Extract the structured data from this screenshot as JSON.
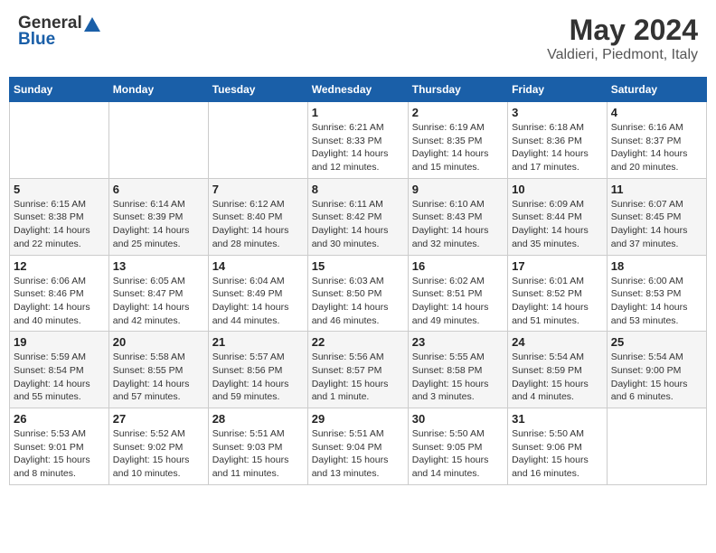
{
  "header": {
    "logo_general": "General",
    "logo_blue": "Blue",
    "month_year": "May 2024",
    "location": "Valdieri, Piedmont, Italy"
  },
  "calendar": {
    "days_of_week": [
      "Sunday",
      "Monday",
      "Tuesday",
      "Wednesday",
      "Thursday",
      "Friday",
      "Saturday"
    ],
    "weeks": [
      [
        {
          "day": "",
          "content": ""
        },
        {
          "day": "",
          "content": ""
        },
        {
          "day": "",
          "content": ""
        },
        {
          "day": "1",
          "content": "Sunrise: 6:21 AM\nSunset: 8:33 PM\nDaylight: 14 hours\nand 12 minutes."
        },
        {
          "day": "2",
          "content": "Sunrise: 6:19 AM\nSunset: 8:35 PM\nDaylight: 14 hours\nand 15 minutes."
        },
        {
          "day": "3",
          "content": "Sunrise: 6:18 AM\nSunset: 8:36 PM\nDaylight: 14 hours\nand 17 minutes."
        },
        {
          "day": "4",
          "content": "Sunrise: 6:16 AM\nSunset: 8:37 PM\nDaylight: 14 hours\nand 20 minutes."
        }
      ],
      [
        {
          "day": "5",
          "content": "Sunrise: 6:15 AM\nSunset: 8:38 PM\nDaylight: 14 hours\nand 22 minutes."
        },
        {
          "day": "6",
          "content": "Sunrise: 6:14 AM\nSunset: 8:39 PM\nDaylight: 14 hours\nand 25 minutes."
        },
        {
          "day": "7",
          "content": "Sunrise: 6:12 AM\nSunset: 8:40 PM\nDaylight: 14 hours\nand 28 minutes."
        },
        {
          "day": "8",
          "content": "Sunrise: 6:11 AM\nSunset: 8:42 PM\nDaylight: 14 hours\nand 30 minutes."
        },
        {
          "day": "9",
          "content": "Sunrise: 6:10 AM\nSunset: 8:43 PM\nDaylight: 14 hours\nand 32 minutes."
        },
        {
          "day": "10",
          "content": "Sunrise: 6:09 AM\nSunset: 8:44 PM\nDaylight: 14 hours\nand 35 minutes."
        },
        {
          "day": "11",
          "content": "Sunrise: 6:07 AM\nSunset: 8:45 PM\nDaylight: 14 hours\nand 37 minutes."
        }
      ],
      [
        {
          "day": "12",
          "content": "Sunrise: 6:06 AM\nSunset: 8:46 PM\nDaylight: 14 hours\nand 40 minutes."
        },
        {
          "day": "13",
          "content": "Sunrise: 6:05 AM\nSunset: 8:47 PM\nDaylight: 14 hours\nand 42 minutes."
        },
        {
          "day": "14",
          "content": "Sunrise: 6:04 AM\nSunset: 8:49 PM\nDaylight: 14 hours\nand 44 minutes."
        },
        {
          "day": "15",
          "content": "Sunrise: 6:03 AM\nSunset: 8:50 PM\nDaylight: 14 hours\nand 46 minutes."
        },
        {
          "day": "16",
          "content": "Sunrise: 6:02 AM\nSunset: 8:51 PM\nDaylight: 14 hours\nand 49 minutes."
        },
        {
          "day": "17",
          "content": "Sunrise: 6:01 AM\nSunset: 8:52 PM\nDaylight: 14 hours\nand 51 minutes."
        },
        {
          "day": "18",
          "content": "Sunrise: 6:00 AM\nSunset: 8:53 PM\nDaylight: 14 hours\nand 53 minutes."
        }
      ],
      [
        {
          "day": "19",
          "content": "Sunrise: 5:59 AM\nSunset: 8:54 PM\nDaylight: 14 hours\nand 55 minutes."
        },
        {
          "day": "20",
          "content": "Sunrise: 5:58 AM\nSunset: 8:55 PM\nDaylight: 14 hours\nand 57 minutes."
        },
        {
          "day": "21",
          "content": "Sunrise: 5:57 AM\nSunset: 8:56 PM\nDaylight: 14 hours\nand 59 minutes."
        },
        {
          "day": "22",
          "content": "Sunrise: 5:56 AM\nSunset: 8:57 PM\nDaylight: 15 hours\nand 1 minute."
        },
        {
          "day": "23",
          "content": "Sunrise: 5:55 AM\nSunset: 8:58 PM\nDaylight: 15 hours\nand 3 minutes."
        },
        {
          "day": "24",
          "content": "Sunrise: 5:54 AM\nSunset: 8:59 PM\nDaylight: 15 hours\nand 4 minutes."
        },
        {
          "day": "25",
          "content": "Sunrise: 5:54 AM\nSunset: 9:00 PM\nDaylight: 15 hours\nand 6 minutes."
        }
      ],
      [
        {
          "day": "26",
          "content": "Sunrise: 5:53 AM\nSunset: 9:01 PM\nDaylight: 15 hours\nand 8 minutes."
        },
        {
          "day": "27",
          "content": "Sunrise: 5:52 AM\nSunset: 9:02 PM\nDaylight: 15 hours\nand 10 minutes."
        },
        {
          "day": "28",
          "content": "Sunrise: 5:51 AM\nSunset: 9:03 PM\nDaylight: 15 hours\nand 11 minutes."
        },
        {
          "day": "29",
          "content": "Sunrise: 5:51 AM\nSunset: 9:04 PM\nDaylight: 15 hours\nand 13 minutes."
        },
        {
          "day": "30",
          "content": "Sunrise: 5:50 AM\nSunset: 9:05 PM\nDaylight: 15 hours\nand 14 minutes."
        },
        {
          "day": "31",
          "content": "Sunrise: 5:50 AM\nSunset: 9:06 PM\nDaylight: 15 hours\nand 16 minutes."
        },
        {
          "day": "",
          "content": ""
        }
      ]
    ]
  }
}
